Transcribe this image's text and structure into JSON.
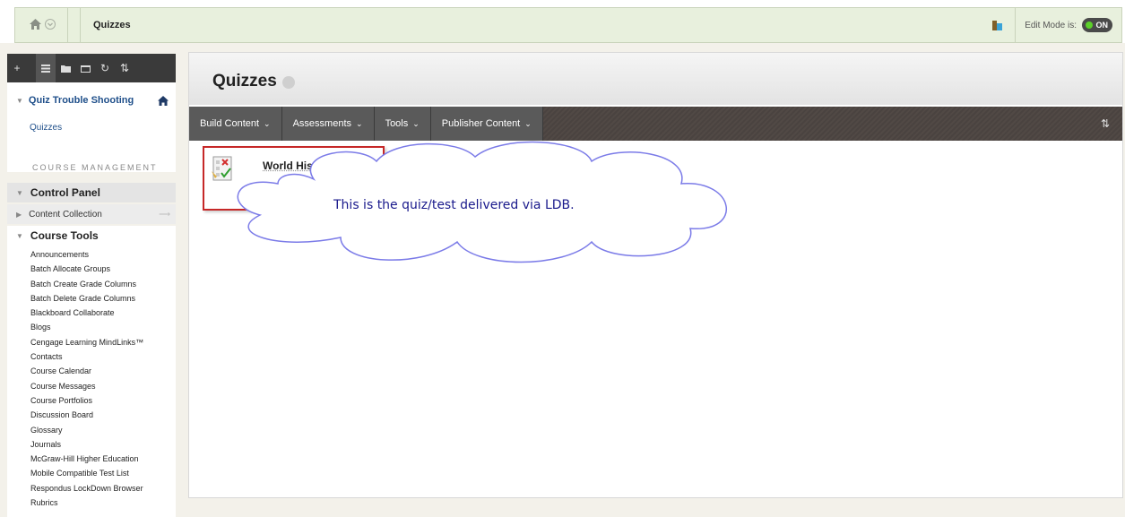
{
  "breadcrumb": {
    "title": "Quizzes"
  },
  "edit_mode": {
    "label": "Edit Mode is:",
    "state": "ON"
  },
  "sidebar": {
    "toolbar_icons": [
      "plus-icon",
      "list-icon",
      "folder-icon",
      "window-icon",
      "refresh-icon",
      "sort-icon"
    ],
    "course_title": "Quiz Trouble Shooting",
    "link": "Quizzes",
    "course_management": "COURSE MANAGEMENT",
    "control_panel": "Control Panel",
    "content_collection": "Content Collection",
    "course_tools_title": "Course Tools",
    "course_tools": [
      "Announcements",
      "Batch Allocate Groups",
      "Batch Create Grade Columns",
      "Batch Delete Grade Columns",
      "Blackboard Collaborate",
      "Blogs",
      "Cengage Learning MindLinks™",
      "Contacts",
      "Course Calendar",
      "Course Messages",
      "Course Portfolios",
      "Discussion Board",
      "Glossary",
      "Journals",
      "McGraw-Hill Higher Education",
      "Mobile Compatible Test List",
      "Respondus LockDown Browser",
      "Rubrics"
    ]
  },
  "main": {
    "page_title": "Quizzes",
    "menu": [
      "Build Content",
      "Assessments",
      "Tools",
      "Publisher Content"
    ],
    "item_title": "World History",
    "callout": "This is the quiz/test delivered via LDB."
  },
  "colors": {
    "accent_green": "#5cd02a",
    "callout_red": "#c62828",
    "cloud_stroke": "#7b7be8"
  }
}
